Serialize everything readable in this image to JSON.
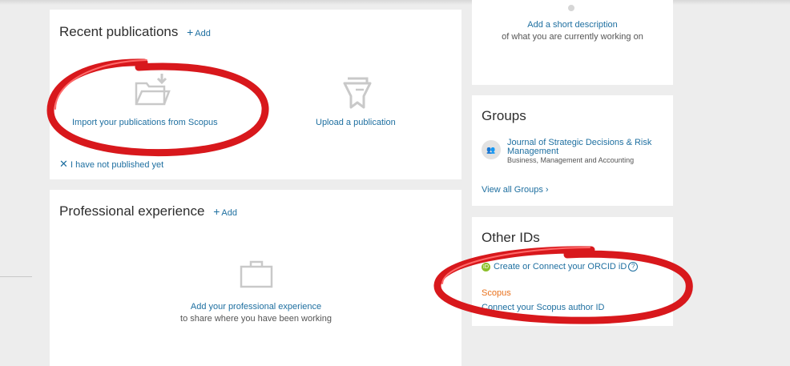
{
  "publications": {
    "title": "Recent publications",
    "add_label": "Add",
    "import_label": "Import your publications from Scopus",
    "upload_label": "Upload a publication",
    "not_published_label": "I have not published yet"
  },
  "experience": {
    "title": "Professional experience",
    "add_label": "Add",
    "add_experience_label": "Add your professional experience",
    "add_experience_sub": "to share where you have been working"
  },
  "description": {
    "add_label": "Add a short description",
    "sub": "of what you are currently working on"
  },
  "groups": {
    "title": "Groups",
    "items": [
      {
        "name_line1": "Journal of Strategic Decisions & Risk",
        "name_line2": "Management",
        "subject": "Business, Management and Accounting"
      }
    ],
    "view_all_label": "View all Groups"
  },
  "other_ids": {
    "title": "Other IDs",
    "orcid_label": "Create or Connect your ORCID iD",
    "scopus_heading": "Scopus",
    "scopus_link": "Connect your Scopus author ID"
  },
  "colors": {
    "link": "#1e6fa0",
    "scopus_orange": "#e9711c",
    "annotation_red": "#d8181c",
    "orcid_green": "#8cbf2a"
  },
  "icons": {
    "import": "folder-import-icon",
    "upload": "upload-publication-icon",
    "experience": "briefcase-icon",
    "group": "group-people-icon",
    "orcid": "orcid-icon",
    "help": "help-icon",
    "close": "close-icon",
    "chevron": "chevron-right-icon"
  }
}
